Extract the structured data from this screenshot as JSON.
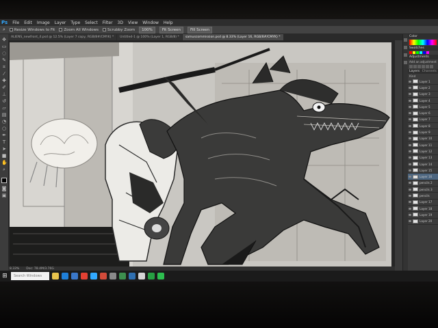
{
  "menubar": {
    "logo": "Ps",
    "items": [
      "File",
      "Edit",
      "Image",
      "Layer",
      "Type",
      "Select",
      "Filter",
      "3D",
      "View",
      "Window",
      "Help"
    ]
  },
  "options": {
    "resize_windows": "Resize Windows to Fit",
    "zoom_all": "Zoom All Windows",
    "scrubby_zoom": "Scrubby Zoom",
    "zoom_level": "100%",
    "fit_screen": "Fit Screen",
    "fill_screen": "Fill Screen"
  },
  "tabs": [
    {
      "label": "ALIENS_newfront_4.psd @ 12.5% (Layer 7 copy, RGB/8#/CMYK) *",
      "active": false
    },
    {
      "label": "Untitled-1 @ 100% (Layer 1, RGB/8) *",
      "active": false
    },
    {
      "label": "samuscommission.psd @ 8.33% (Layer 16, RGB/8#/CMYK) *",
      "active": true
    }
  ],
  "status": {
    "zoom": "8.33%",
    "doc": "Doc: 78.4M/3.76G"
  },
  "panels": {
    "color": "Color",
    "swatches": "Swatches",
    "adjustments": "Adjustments",
    "add_adjustment": "Add an adjustment",
    "layers": "Layers",
    "channels": "Channels",
    "kind": "Kind",
    "layer_names": [
      "Layer 1",
      "Layer 2",
      "Layer 3",
      "Layer 4",
      "Layer 5",
      "Layer 6",
      "Layer 7",
      "Layer 8",
      "Layer 9",
      "Layer 10",
      "Layer 11",
      "Layer 12",
      "Layer 13",
      "Layer 14",
      "Layer 15",
      "Layer 16",
      "pencils 2",
      "pencils 3",
      "pencils",
      "Layer 17",
      "Layer 18",
      "Layer 19",
      "Layer 20"
    ],
    "selected_layer": "Layer 16"
  },
  "taskbar": {
    "search_placeholder": "Search Windows",
    "apps": [
      "file-explorer",
      "edge",
      "store",
      "chrome",
      "photoshop",
      "media",
      "spotify",
      "whatsapp",
      "mail",
      "steam",
      "notepad",
      "settings"
    ]
  },
  "colors": {
    "accent": "#31a8ff",
    "selection": "#4d6680"
  }
}
